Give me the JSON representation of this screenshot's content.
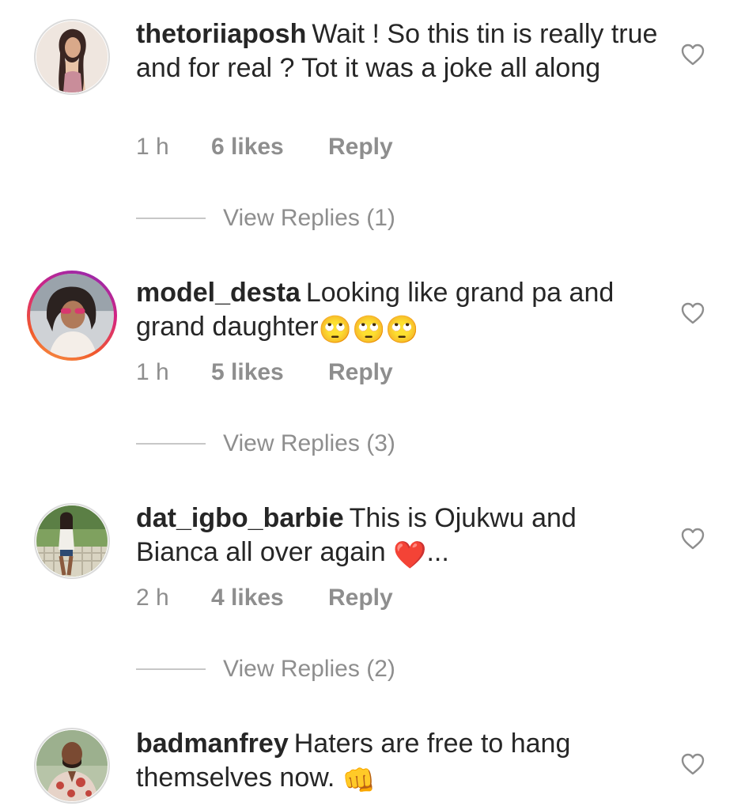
{
  "comments": [
    {
      "username": "thetoriiaposh",
      "text": "Wait ! So this tin is really true and for real ? Tot it was a joke all along",
      "time": "1 h",
      "likes": "6 likes",
      "reply": "Reply",
      "view_replies": "View Replies (1)",
      "avatar_icon": "profile-photo-icon",
      "has_story_ring": false
    },
    {
      "username": "model_desta",
      "text": "Looking like grand pa and grand daughter",
      "text_emoji": "🙄🙄🙄",
      "time": "1 h",
      "likes": "5 likes",
      "reply": "Reply",
      "view_replies": "View Replies (3)",
      "avatar_icon": "profile-photo-icon",
      "has_story_ring": true
    },
    {
      "username": "dat_igbo_barbie",
      "text": "This is Ojukwu and Bianca all over again",
      "text_emoji": "❤️",
      "text_suffix": "...",
      "time": "2 h",
      "likes": "4 likes",
      "reply": "Reply",
      "view_replies": "View Replies (2)",
      "avatar_icon": "profile-photo-icon",
      "has_story_ring": false
    },
    {
      "username": "badmanfrey",
      "text": "Haters are free to hang themselves now.",
      "text_emoji": "👊",
      "avatar_icon": "profile-photo-icon",
      "has_story_ring": false
    }
  ],
  "icons": {
    "like": "heart-outline-icon"
  },
  "colors": {
    "text": "#262626",
    "secondary": "#8e8e8e",
    "divider": "#c7c7c7",
    "story_ring_start": "#8a2ab6",
    "story_ring_end": "#f7a14a"
  }
}
